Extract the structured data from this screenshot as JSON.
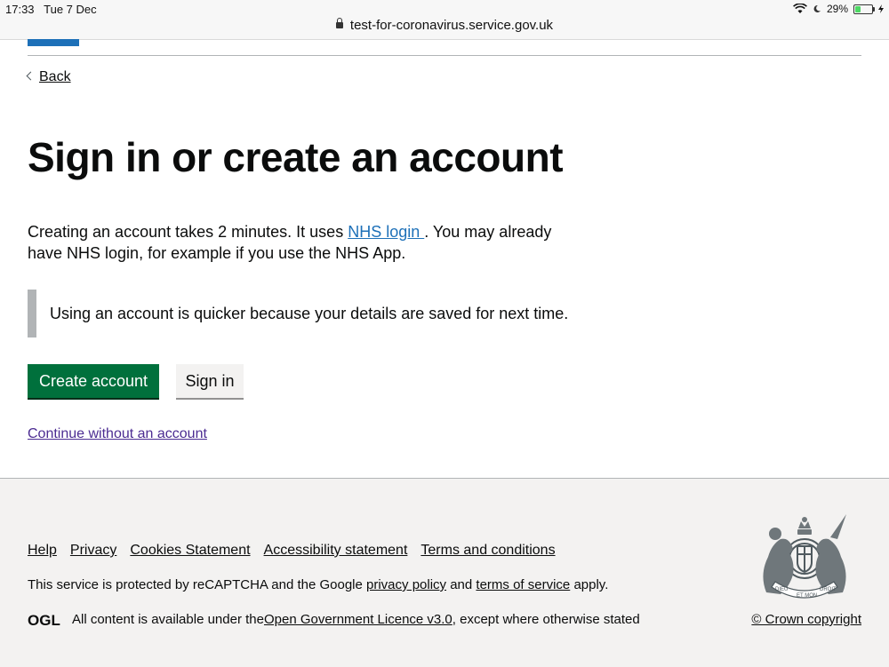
{
  "statusbar": {
    "time": "17:33",
    "date": "Tue 7 Dec",
    "url": "test-for-coronavirus.service.gov.uk",
    "battery": "29%"
  },
  "nav": {
    "back": "Back"
  },
  "main": {
    "heading": "Sign in or create an account",
    "intro_before": "Creating an account takes 2 minutes. It uses ",
    "intro_link": "NHS login ",
    "intro_after": ". You may already have NHS login, for example if you use the NHS App.",
    "inset_text": "Using an account is quicker because your details are saved for next time.",
    "create_button": "Create account",
    "signin_button": "Sign in",
    "continue_link": "Continue without an account"
  },
  "footer": {
    "links": [
      "Help",
      "Privacy",
      "Cookies Statement",
      "Accessibility statement",
      "Terms and conditions"
    ],
    "recaptcha_before": "This service is protected by reCAPTCHA and the Google ",
    "privacy_policy": "privacy policy",
    "recaptcha_mid": " and ",
    "terms_of_service": "terms of service",
    "recaptcha_after": " apply.",
    "ogl_label": "OGL",
    "licence_before": "All content is available under the ",
    "licence_link": "Open Government Licence v3.0",
    "licence_after": ", except where otherwise stated",
    "crown_copyright": "© Crown copyright",
    "crest_motto_left": "DIEU",
    "crest_motto_right": "DROIT",
    "crest_motto_bottom": "ET MON"
  },
  "colors": {
    "primary_button": "#00703c",
    "link": "#1d70b8",
    "visited_link": "#4c2c92",
    "footer_bg": "#f3f2f1"
  }
}
